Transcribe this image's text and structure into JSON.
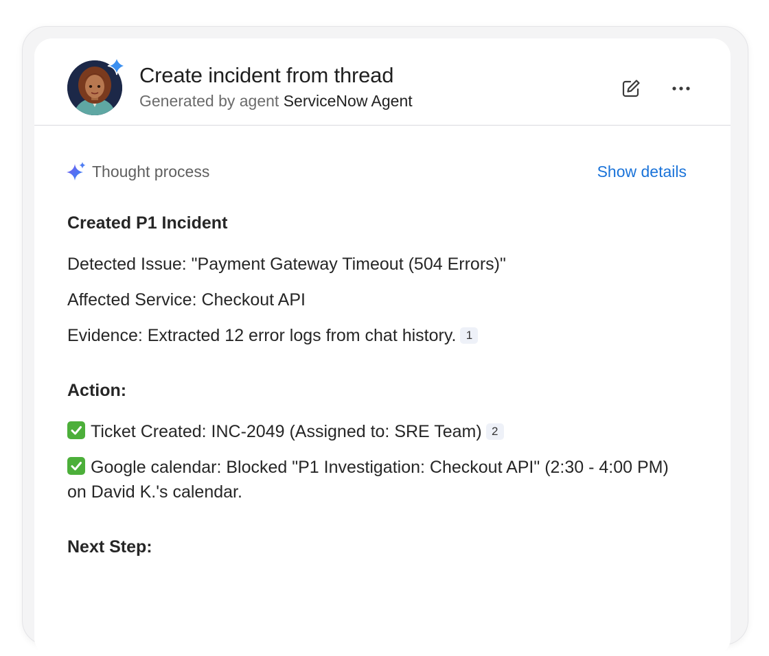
{
  "header": {
    "title": "Create incident from thread",
    "subtitle_prefix": "Generated by agent",
    "agent_name": "ServiceNow Agent",
    "avatar": "agent-avatar",
    "sparkle_color": "#3b8ff0"
  },
  "toolbar": {
    "edit_icon": "edit-icon",
    "more_icon": "more-horizontal-icon"
  },
  "thought": {
    "label": "Thought process",
    "toggle_label": "Show details",
    "link_color": "#1a73d9"
  },
  "summary": {
    "heading": "Created P1 Incident",
    "detected_issue": "Detected Issue: \"Payment Gateway Timeout (504 Errors)\"",
    "affected_service": "Affected Service: Checkout API",
    "evidence": "Evidence: Extracted 12 error logs from chat history.",
    "evidence_citation": "1"
  },
  "action": {
    "heading": "Action:",
    "items": [
      {
        "text": "Ticket Created: INC-2049 (Assigned to: SRE Team)",
        "citation": "2",
        "icon": "check-mark-icon"
      },
      {
        "text": "Google calendar: Blocked \"P1 Investigation: Checkout API\" (2:30 - 4:00 PM) on David K.'s calendar.",
        "icon": "check-mark-icon"
      }
    ]
  },
  "next_step": {
    "heading": "Next Step:"
  }
}
